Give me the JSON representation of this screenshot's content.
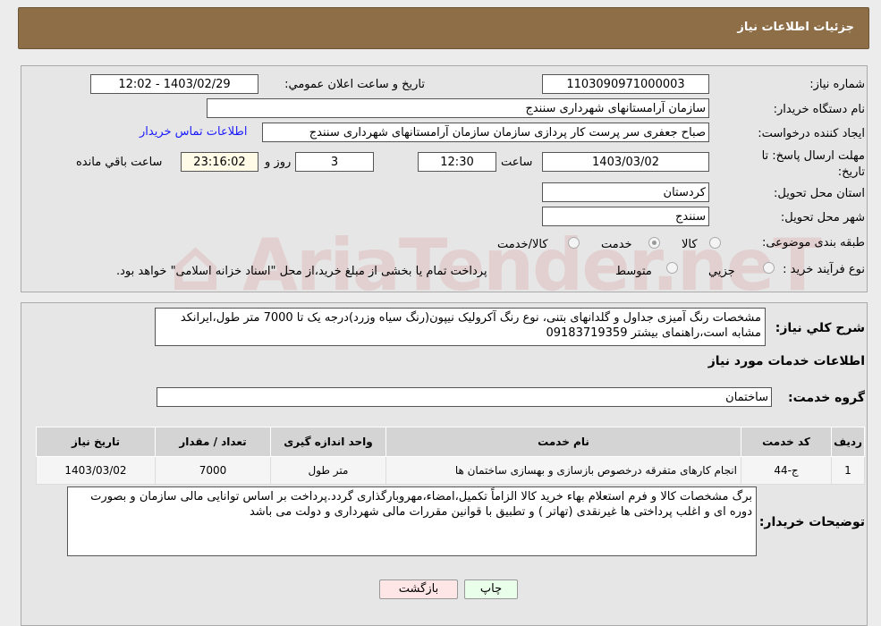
{
  "header": {
    "title": "جزئیات اطلاعات نیاز"
  },
  "form": {
    "need_number_label": "شماره نیاز:",
    "need_number": "1103090971000003",
    "announce_label": "تاریخ و ساعت اعلان عمومي:",
    "announce_value": "1403/02/29 - 12:02",
    "buyer_org_label": "نام دستگاه خريدار:",
    "buyer_org": "سازمان آرامستانهای شهرداری سنندج",
    "creator_label": "ايجاد کننده درخواست:",
    "creator": "صباح جعفری سر پرست کار پردازی سازمان  سازمان آرامستانهای شهرداری سنندج",
    "contact_link": "اطلاعات تماس خريدار",
    "deadline_label": "مهلت ارسال پاسخ: تا تاریخ:",
    "deadline_date": "1403/03/02",
    "time_label": "ساعت",
    "deadline_time": "12:30",
    "days": "3",
    "days_label": "روز و",
    "remaining": "23:16:02",
    "remaining_label": "ساعت باقي مانده",
    "province_label": "استان محل تحويل:",
    "province": "کردستان",
    "city_label": "شهر محل تحويل:",
    "city": "سنندج",
    "category_label": "طبقه بندی موضوعی:",
    "category_options": [
      "کالا",
      "خدمت",
      "کالا/خدمت"
    ],
    "category_selected": "خدمت",
    "process_label": "نوع فرآيند خريد :",
    "process_options": [
      "جزيي",
      "متوسط"
    ],
    "process_note": "پرداخت تمام يا بخشی از مبلغ خريد،از محل \"اسناد خزانه اسلامی\" خواهد بود."
  },
  "watermark": "AriaTender.neT",
  "description": {
    "label": "شرح کلي نياز:",
    "text": "مشخصات رنگ آمیزی جداول و گلدانهای بتنی، نوع رنگ آکرولیک نیپون(رنگ سیاه وزرد)درجه یک تا 7000 متر طول،ایرانکد مشابه است،راهنمای بیشتر 09183719359"
  },
  "services": {
    "title": "اطلاعات خدمات مورد نياز",
    "group_label": "گروه خدمت:",
    "group": "ساختمان",
    "columns": [
      "رديف",
      "کد خدمت",
      "نام خدمت",
      "واحد اندازه گيری",
      "تعداد / مقدار",
      "تاريخ نياز"
    ],
    "rows": [
      [
        "1",
        "ج-44",
        "انجام کارهای متفرقه درخصوص بازسازی و بهسازی ساختمان ها",
        "متر طول",
        "7000",
        "1403/03/02"
      ]
    ]
  },
  "buyer_notes": {
    "label": "توضيحات خريدار:",
    "text": "برگ مشخصات کالا و فرم استعلام بهاء خرید کالا الزاماً تکمیل،امضاء،مهروبارگذاری گردد.پرداخت بر اساس توانایی مالی سازمان  و بصورت دوره ای و اغلب پرداختی ها  غیرنقدی (تهاتر ) و تطبیق با قوانین مقررات مالی شهرداری و دولت می باشد"
  },
  "buttons": {
    "print": "چاپ",
    "back": "بازگشت"
  },
  "colors": {
    "header": "#8d6e47",
    "print_btn": "#eaffea",
    "back_btn": "#ffe6e6"
  }
}
